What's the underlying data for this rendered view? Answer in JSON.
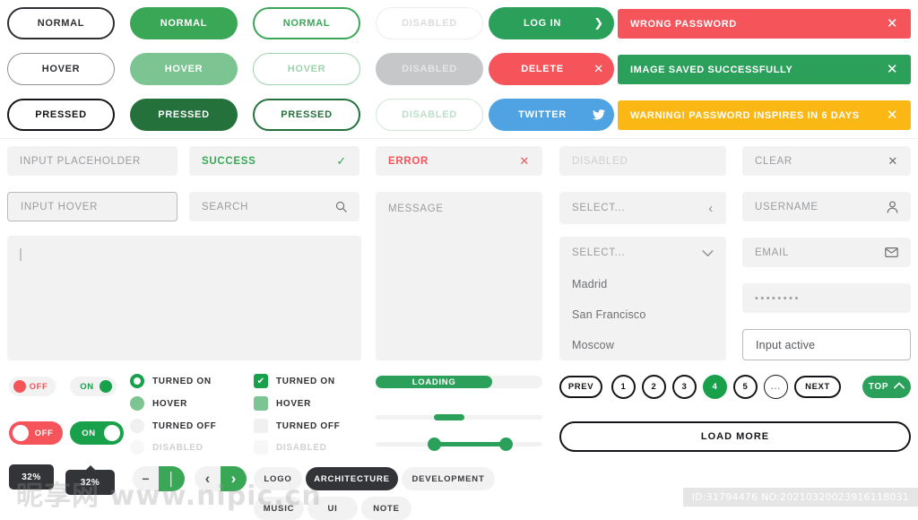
{
  "buttons": {
    "outline": [
      {
        "label": "NORMAL",
        "state": "normal"
      },
      {
        "label": "HOVER",
        "state": "hover"
      },
      {
        "label": "PRESSED",
        "state": "pressed"
      }
    ],
    "solid": [
      {
        "label": "NORMAL",
        "state": "normal"
      },
      {
        "label": "HOVER",
        "state": "hover"
      },
      {
        "label": "PRESSED",
        "state": "pressed"
      }
    ],
    "ghost": [
      {
        "label": "NORMAL",
        "state": "normal"
      },
      {
        "label": "HOVER",
        "state": "hover"
      },
      {
        "label": "PRESSED",
        "state": "pressed"
      }
    ],
    "disabled": [
      {
        "label": "DISABLED"
      },
      {
        "label": "DISABLED"
      },
      {
        "label": "DISABLED"
      }
    ],
    "icon": [
      {
        "label": "LOG IN",
        "icon": "chevron-right-icon",
        "glyph": "❯",
        "color": "#2aa05a"
      },
      {
        "label": "DELETE",
        "icon": "close-icon",
        "glyph": "✕",
        "color": "#f4545a"
      },
      {
        "label": "TWITTER",
        "icon": "twitter-bird-icon",
        "glyph": "ᴠ",
        "color": "#4fa3e3"
      }
    ]
  },
  "alerts": [
    {
      "text": "WRONG PASSWORD",
      "type": "error",
      "color": "#f4545a",
      "close": "✕"
    },
    {
      "text": "IMAGE SAVED SUCCESSFULLY",
      "type": "success",
      "color": "#2aa05a",
      "close": "✕"
    },
    {
      "text": "WARNING! PASSWORD INSPIRES IN 6 DAYS",
      "type": "warning",
      "color": "#fbb714",
      "close": "✕"
    }
  ],
  "inputs": {
    "placeholder": "INPUT PLACEHOLDER",
    "hover": "INPUT HOVER",
    "success": "SUCCESS",
    "success_icon": "✓",
    "search": "SEARCH",
    "search_icon": "⌕",
    "error": "ERROR",
    "error_icon": "✕",
    "message": "MESSAGE",
    "disabled": "DISABLED",
    "clear": "CLEAR",
    "clear_icon": "✕",
    "username": "USERNAME",
    "username_icon": "⛉",
    "email": "EMAIL",
    "email_icon": "✉",
    "password": "••••••••",
    "active": "Input active"
  },
  "selects": {
    "collapsed_label": "SELECT...",
    "collapsed_icon": "‹",
    "open_label": "SELECT...",
    "open_icon": "∨",
    "options": [
      "Madrid",
      "San Francisco",
      "Moscow"
    ]
  },
  "toggles": [
    {
      "label": "OFF",
      "state": "off",
      "size": "small"
    },
    {
      "label": "ON",
      "state": "on",
      "size": "small"
    },
    {
      "label": "OFF",
      "state": "off",
      "size": "large"
    },
    {
      "label": "ON",
      "state": "on",
      "size": "large"
    }
  ],
  "radios": [
    {
      "label": "TURNED ON",
      "state": "on"
    },
    {
      "label": "HOVER",
      "state": "hover"
    },
    {
      "label": "TURNED OFF",
      "state": "off"
    },
    {
      "label": "DISABLED",
      "state": "disabled"
    }
  ],
  "checkboxes": [
    {
      "label": "TURNED ON",
      "state": "on",
      "glyph": "✔"
    },
    {
      "label": "HOVER",
      "state": "hover",
      "glyph": ""
    },
    {
      "label": "TURNED OFF",
      "state": "off",
      "glyph": ""
    },
    {
      "label": "DISABLED",
      "state": "disabled",
      "glyph": ""
    }
  ],
  "progress": {
    "loading_label": "LOADING",
    "loading_percent": 68,
    "slider_single_percent": 34,
    "range_low_percent": 35,
    "range_high_percent": 77
  },
  "pagination": {
    "prev": "PREV",
    "pages": [
      "1",
      "2",
      "3",
      "4",
      "5"
    ],
    "active_page": "4",
    "dots": "...",
    "next": "NEXT",
    "top": "TOP",
    "top_icon": "⌃",
    "load_more": "LOAD MORE"
  },
  "tooltips": [
    {
      "value": "32%",
      "pointer": false
    },
    {
      "value": "32%",
      "pointer": true
    }
  ],
  "steppers": [
    {
      "left": "−",
      "right": "│",
      "left_icon": "minus-icon",
      "right_icon": "plus-icon"
    },
    {
      "left": "‹",
      "right": "›",
      "left_icon": "chevron-left-icon",
      "right_icon": "chevron-right-icon"
    }
  ],
  "tags": {
    "row1": [
      {
        "label": "LOGO",
        "selected": false
      },
      {
        "label": "ARCHITECTURE",
        "selected": true
      },
      {
        "label": "DEVELOPMENT",
        "selected": false
      }
    ],
    "row2": [
      {
        "label": "MUSIC",
        "selected": false
      },
      {
        "label": "UI",
        "selected": false
      },
      {
        "label": "NOTE",
        "selected": false
      }
    ]
  },
  "watermark": {
    "text": "昵享网 www.nipic.cn",
    "id_text": "ID:31794476 NO:20210320023916118031"
  },
  "theme": {
    "green": "#3aa757",
    "green_dark": "#24713c",
    "green_light": "#7cc492",
    "red": "#f4545a",
    "orange": "#fbb714",
    "blue": "#4fa3e3",
    "dark": "#333437",
    "field_bg": "#f2f2f2"
  }
}
